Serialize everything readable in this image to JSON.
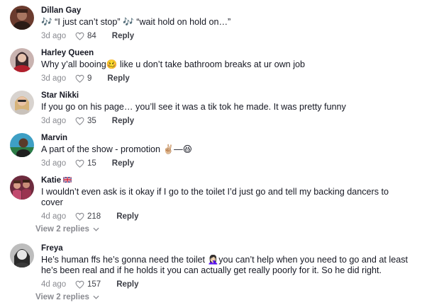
{
  "comments": [
    {
      "username": "Dillan Gay",
      "text": "🎶 “I just can’t stop” 🎶 “wait hold on hold on…”",
      "date": "3d ago",
      "likes": "84",
      "reply_label": "Reply"
    },
    {
      "username": "Harley Queen",
      "text": "Why y’all booing🥴 like u don’t take bathroom breaks at ur own job",
      "date": "3d ago",
      "likes": "9",
      "reply_label": "Reply"
    },
    {
      "username": "Star Nikki",
      "text": "If you go on his page… you’ll see it was a tik tok he made. It was pretty funny",
      "date": "3d ago",
      "likes": "35",
      "reply_label": "Reply"
    },
    {
      "username": "Marvin",
      "text": "A part of the show - promotion ✌🏼—😆",
      "date": "3d ago",
      "likes": "15",
      "reply_label": "Reply"
    },
    {
      "username": "Katie",
      "flag": "uk-flag",
      "text_lines": [
        "I wouldn’t even ask is it okay if I go to the toilet I’d just go and tell my backing dancers to",
        "cover"
      ],
      "date": "4d ago",
      "likes": "218",
      "reply_label": "Reply",
      "view_replies": "View 2 replies"
    },
    {
      "username": "Freya",
      "text_lines": [
        "He’s human ffs he’s gonna need the toilet 🤦🏻‍♀️you can’t help when you need to go and at least",
        "he’s been real and if he holds it you can actually get really poorly for it. So he did right."
      ],
      "date": "4d ago",
      "likes": "157",
      "reply_label": "Reply",
      "view_replies": "View 2 replies"
    }
  ],
  "colors": {
    "text": "#161823",
    "muted": "#8a8b91",
    "background": "#ffffff"
  },
  "icons": {
    "like": "heart-outline-icon",
    "expand": "chevron-down-icon"
  }
}
